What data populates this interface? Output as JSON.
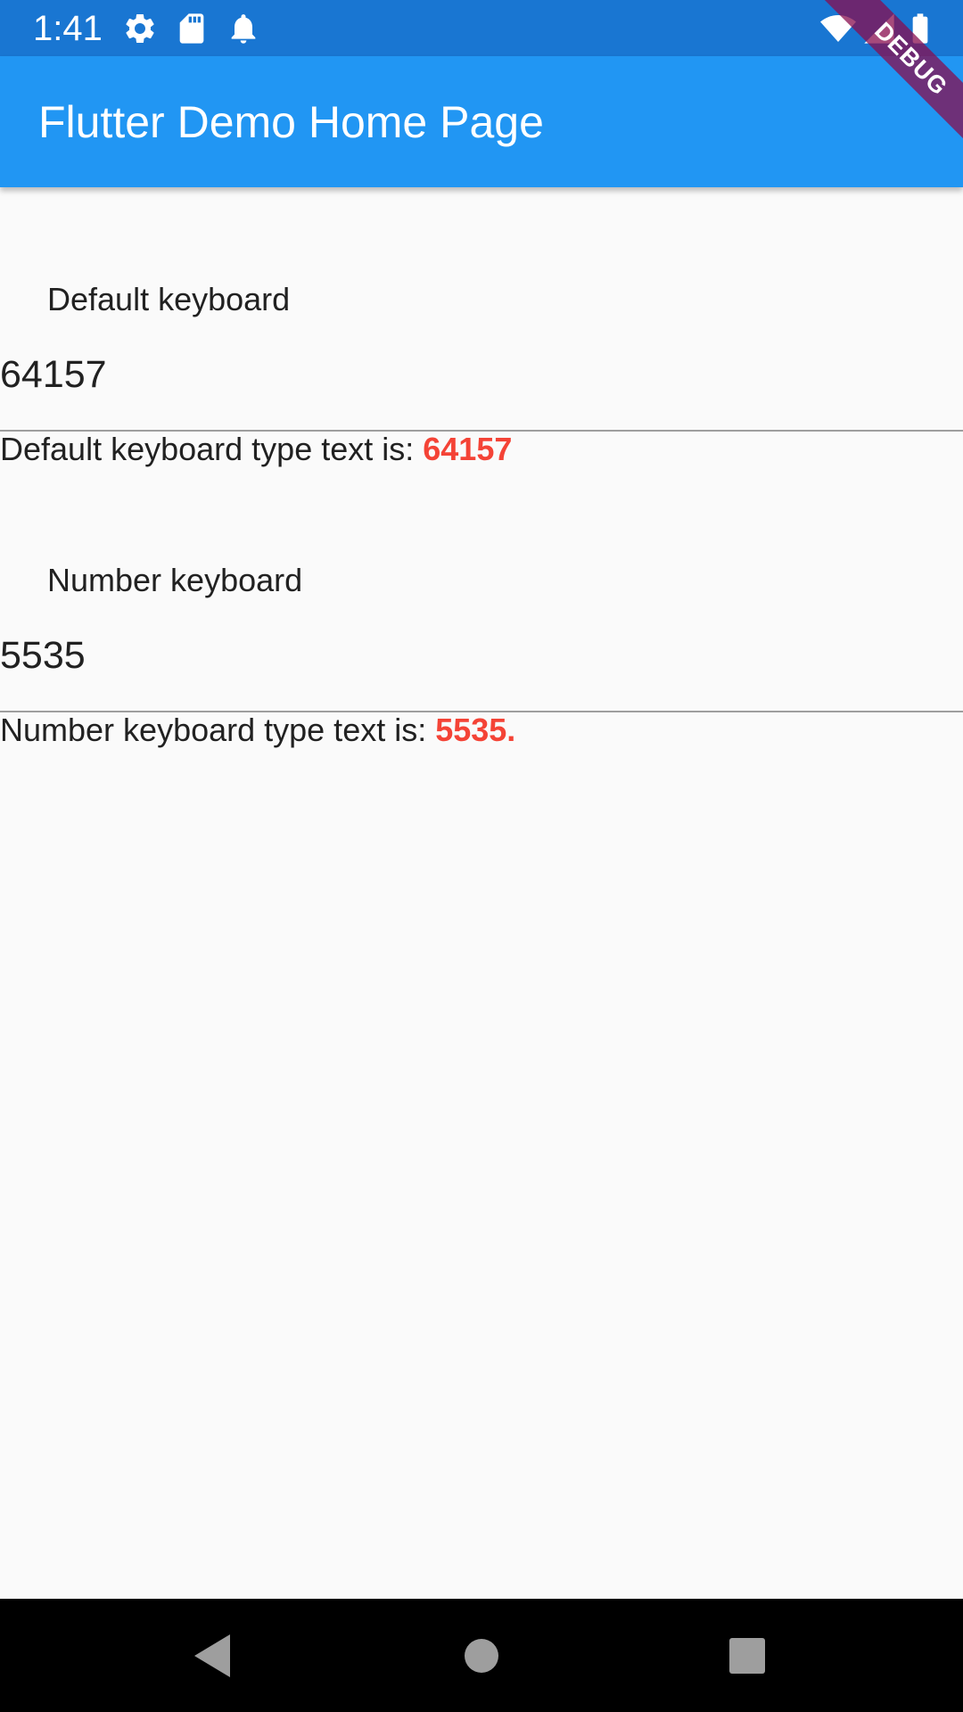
{
  "status_bar": {
    "time": "1:41",
    "left_icons": [
      "gear-icon",
      "sd-card-icon",
      "bell-icon"
    ],
    "right_icons": [
      "wifi-icon",
      "cell-signal-icon",
      "battery-icon"
    ],
    "color": "#1976d2"
  },
  "app_bar": {
    "title": "Flutter Demo Home Page",
    "color": "#2196f3"
  },
  "debug_banner": {
    "label": "DEBUG"
  },
  "fields": [
    {
      "label": "Default keyboard",
      "value": "64157",
      "result_prefix": "Default keyboard type text is: ",
      "result_value": "64157"
    },
    {
      "label": "Number keyboard",
      "value": "5535",
      "result_prefix": "Number keyboard type text is: ",
      "result_value": "5535."
    }
  ],
  "nav_bar": {
    "buttons": [
      "back-icon",
      "home-icon",
      "recents-icon"
    ]
  },
  "colors": {
    "accent_red": "#f44336",
    "background": "#fafafa"
  }
}
